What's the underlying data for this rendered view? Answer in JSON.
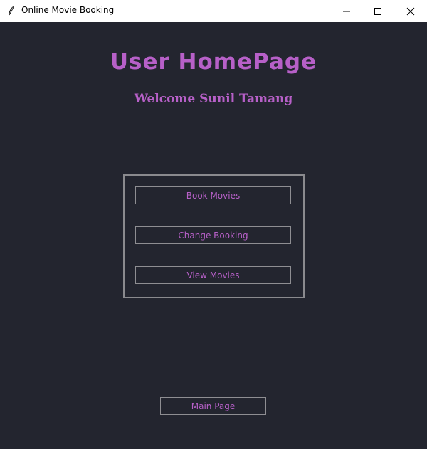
{
  "window": {
    "title": "Online Movie Booking",
    "icon": "feather-icon",
    "controls": [
      "minimize-icon",
      "maximize-icon",
      "close-icon"
    ]
  },
  "page": {
    "title": "User HomePage",
    "welcome": "Welcome Sunil Tamang"
  },
  "menu": {
    "book_label": "Book Movies",
    "change_label": "Change Booking",
    "view_label": "View Movies"
  },
  "footer": {
    "main_label": "Main Page"
  },
  "colors": {
    "background": "#23252f",
    "accent": "#b760c8",
    "border": "#8a8a8e"
  }
}
